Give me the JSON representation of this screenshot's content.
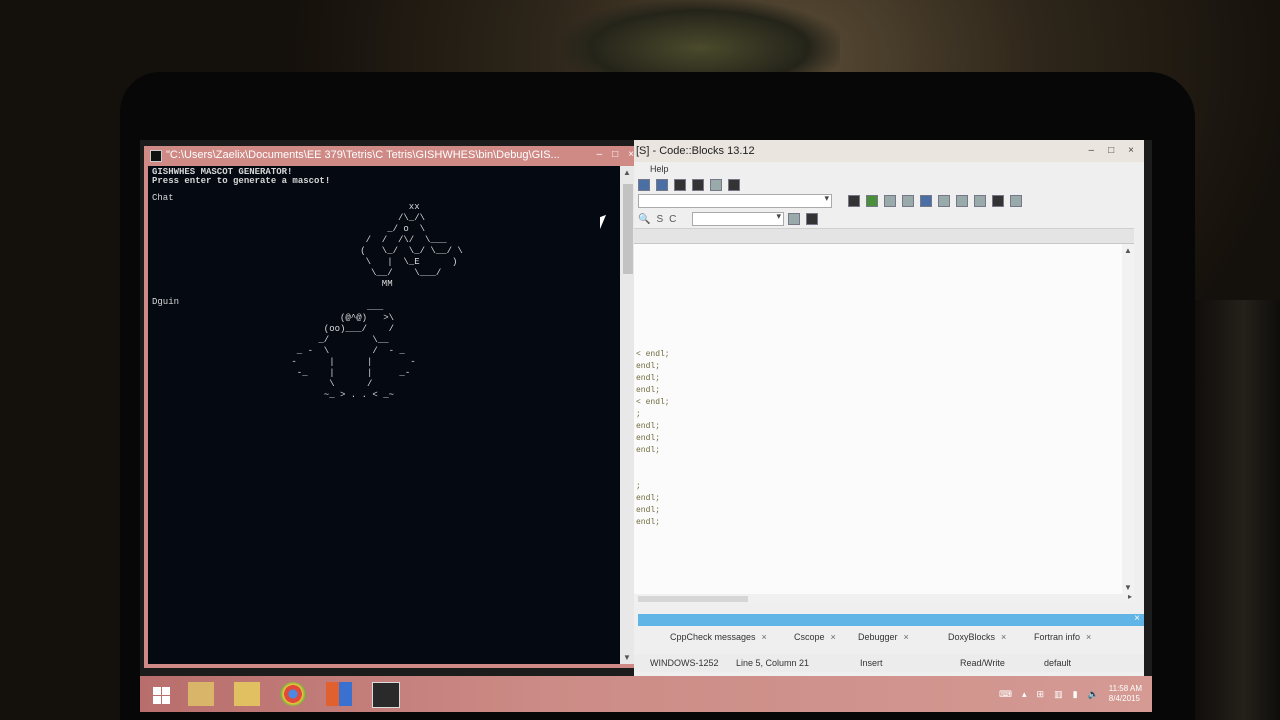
{
  "console": {
    "title": "\"C:\\Users\\Zaelix\\Documents\\EE 379\\Tetris\\C Tetris\\GISHWHES\\bin\\Debug\\GIS...",
    "buttons": [
      "–",
      "□",
      "×"
    ],
    "lines": [
      "GISHWHES MASCOT GENERATOR!",
      "Press enter to generate a mascot!",
      "Chat",
      "Dguin"
    ],
    "art1": "            xx\n          /\\_/\\\n        _/ o  \\\n    /  /  /\\/  \\___\n   (   \\_/  \\_/ \\__/ \\\n    \\   |  \\_E      )\n     \\__/    \\___/\n       MM",
    "art2": "               ___\n          (@^@)   >\\\n       (oo)___/    /\n      _/        \\__\n  _ -  \\        /  - _\n -      |      |       -\n  -_    |      |     _-\n        \\      /\n       ~_ > . . < _~"
  },
  "codeblocks": {
    "title": "[S] - Code::Blocks 13.12",
    "title_buttons": [
      "–",
      "□",
      "×"
    ],
    "menu_help": "Help",
    "code_lines": [
      "< endl;",
      "endl;",
      "endl;",
      "endl;",
      "< endl;",
      ";",
      "endl;",
      "endl;",
      "endl;",
      ";",
      "endl;",
      "endl;",
      "endl;"
    ],
    "log_tabs": [
      "CppCheck messages",
      "Cscope",
      "Debugger",
      "DoxyBlocks",
      "Fortran info"
    ],
    "status": {
      "encoding": "WINDOWS-1252",
      "position": "Line 5, Column 21",
      "mode": "Insert",
      "access": "Read/Write",
      "profile": "default"
    }
  },
  "taskbar": {
    "time": "11:58 AM",
    "date": "8/4/2015"
  },
  "colors": {
    "console_frame": "#cf8a86",
    "console_bg": "#050a12",
    "log_bar": "#61b4e6",
    "taskbar": "#cc8b86"
  }
}
